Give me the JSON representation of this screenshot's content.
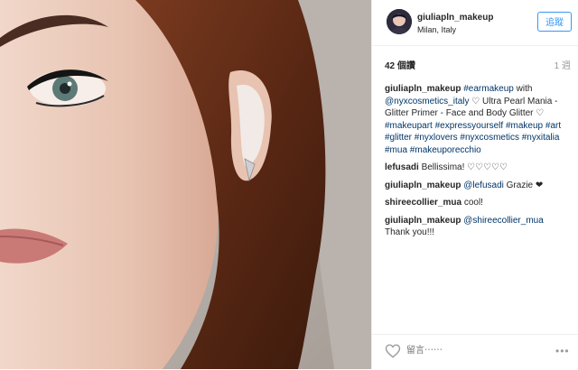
{
  "header": {
    "username": "giuliapln_makeup",
    "location": "Milan, Italy",
    "follow_label": "追蹤"
  },
  "meta": {
    "likes": "42 個讚",
    "time": "1 週"
  },
  "caption": {
    "user": "giuliapln_makeup",
    "parts": [
      "#earmakeup",
      " with ",
      "@nyxcosmetics_italy",
      " ♡ Ultra Pearl Mania - Glitter Primer - Face and Body Glitter ♡ ",
      "#makeupart",
      " ",
      "#expressyourself",
      " ",
      "#makeup",
      " ",
      "#art",
      " ",
      "#glitter",
      " ",
      "#nyxlovers",
      " ",
      "#nyxcosmetics",
      " ",
      "#nyxitalia",
      " ",
      "#mua",
      " ",
      "#makeuporecchio"
    ]
  },
  "comments": [
    {
      "user": "lefusadi",
      "text": "Bellissima! ♡♡♡♡♡",
      "mention": ""
    },
    {
      "user": "giuliapln_makeup",
      "mention": "@lefusadi",
      "text": " Grazie ❤"
    },
    {
      "user": "shireecollier_mua",
      "text": "cool!",
      "mention": ""
    },
    {
      "user": "giuliapln_makeup",
      "mention": "@shireecollier_mua",
      "text": " Thank you!!!"
    }
  ],
  "footer": {
    "comment_placeholder": "留言⋯⋯",
    "more_label": "•••"
  },
  "colors": {
    "link": "#003569",
    "follow": "#3897f0"
  },
  "icons": {
    "like": "heart-icon",
    "more": "more-options-icon"
  }
}
